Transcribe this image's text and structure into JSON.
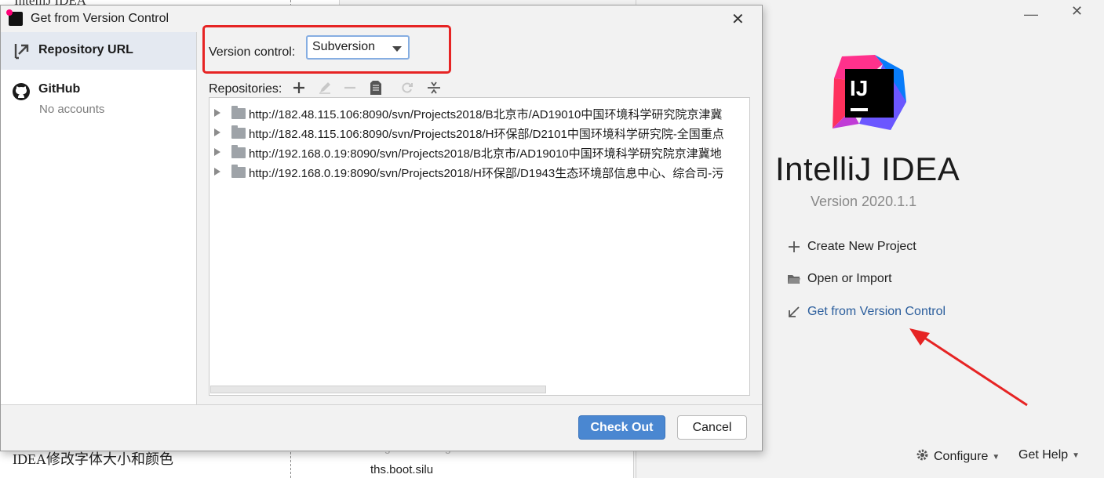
{
  "background": {
    "top_text": "IntelliJ IDEA",
    "bottom_text": "IDEA修改字体大小和颜色",
    "list_faded_text": "… g … … … n g …",
    "list_text": "ths.boot.silu"
  },
  "welcome": {
    "app_name": "IntelliJ IDEA",
    "version": "Version 2020.1.1",
    "window_controls": {
      "minimize": "—",
      "close": "✕"
    },
    "actions": [
      {
        "label": "Create New Project",
        "icon": "plus-icon"
      },
      {
        "label": "Open or Import",
        "icon": "folder-open-icon"
      },
      {
        "label": "Get from Version Control",
        "icon": "arrow-down-left-icon"
      }
    ],
    "footer": {
      "configure": "Configure",
      "get_help": "Get Help"
    },
    "annotation_color": "#e62424"
  },
  "dialog": {
    "title": "Get from Version Control",
    "close": "✕",
    "sidebar": [
      {
        "label": "Repository URL",
        "sub": "",
        "icon": "vcs-arrow-icon"
      },
      {
        "label": "GitHub",
        "sub": "No accounts",
        "icon": "github-icon"
      }
    ],
    "version_control_label": "Version control:",
    "version_control_value": "Subversion",
    "repositories_label": "Repositories:",
    "repositories": [
      "http://182.48.115.106:8090/svn/Projects2018/B北京市/AD19010中国环境科学研究院京津冀",
      "http://182.48.115.106:8090/svn/Projects2018/H环保部/D2101中国环境科学研究院-全国重点",
      "http://192.168.0.19:8090/svn/Projects2018/B北京市/AD19010中国环境科学研究院京津冀地",
      "http://192.168.0.19:8090/svn/Projects2018/H环保部/D1943生态环境部信息中心、综合司-污"
    ],
    "buttons": {
      "checkout": "Check Out",
      "cancel": "Cancel"
    },
    "accent_color": "#4a87d1"
  }
}
